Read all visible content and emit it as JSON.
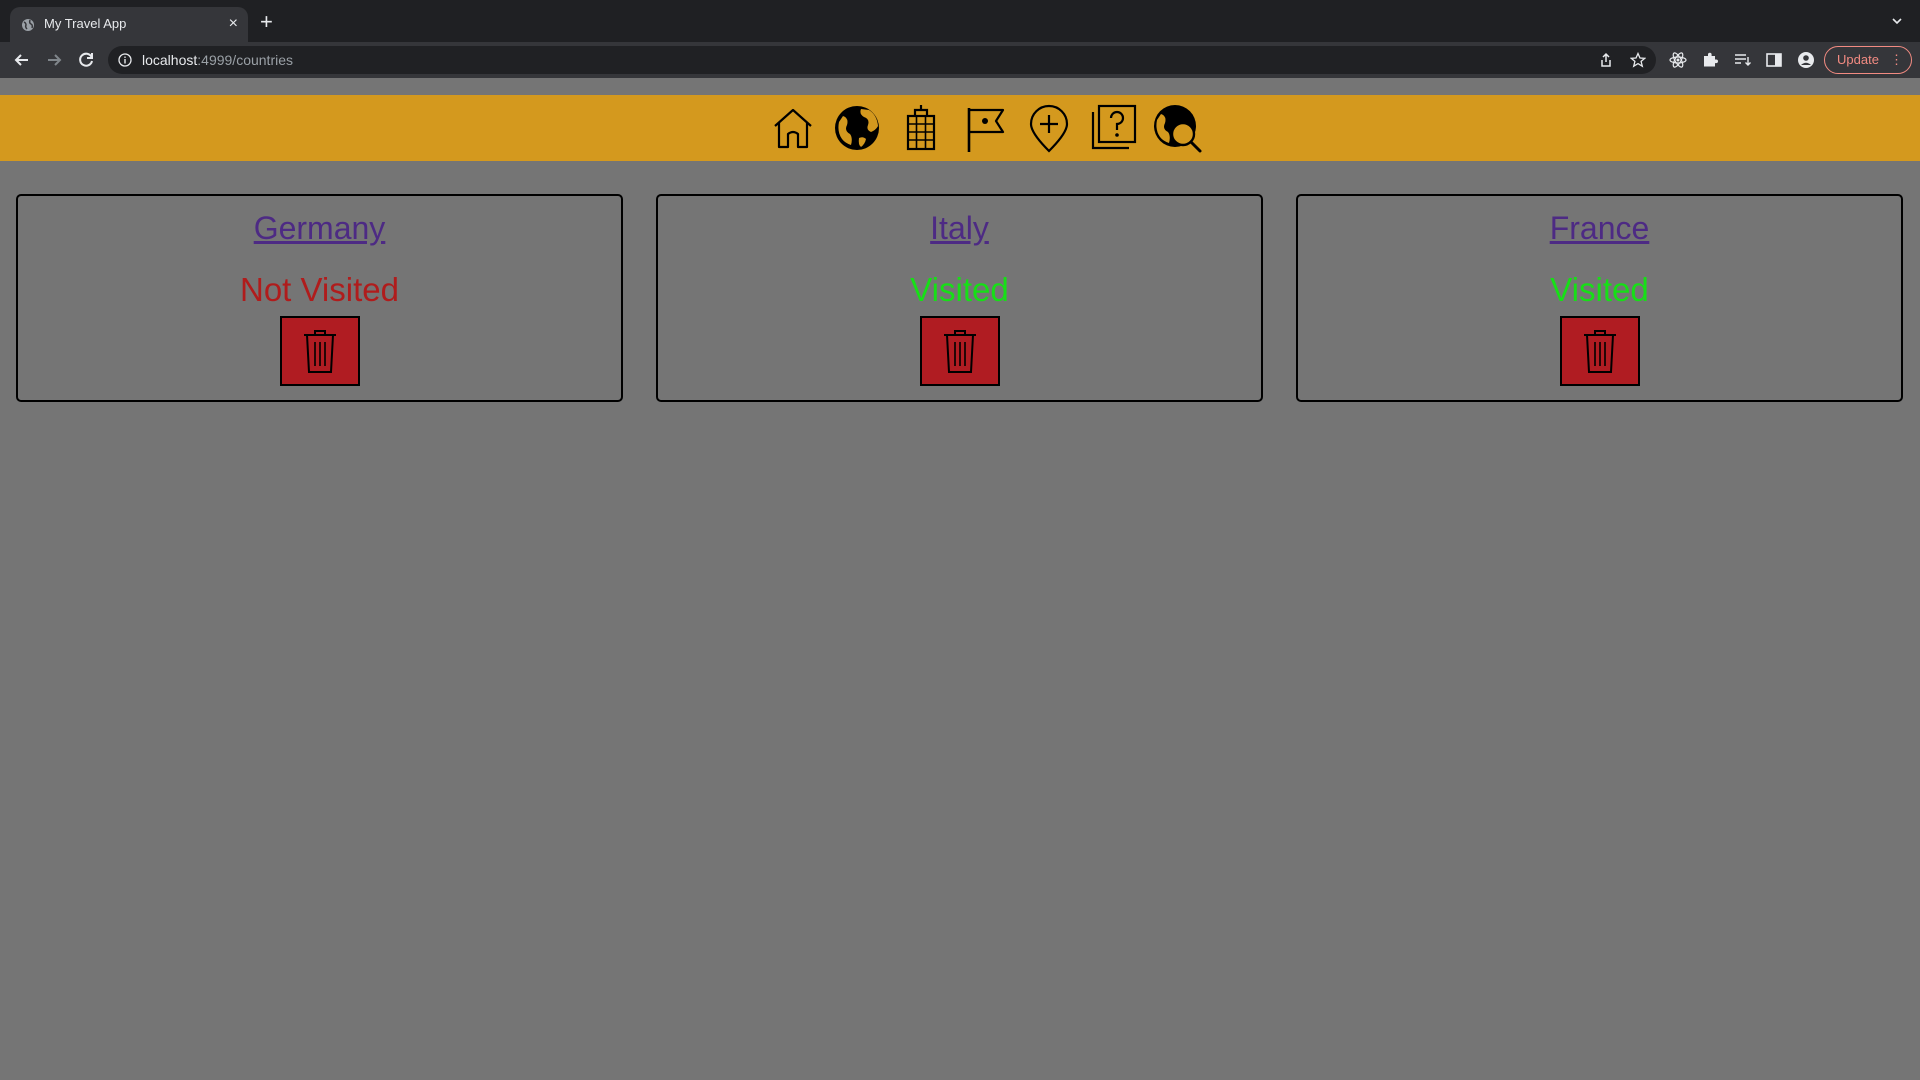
{
  "browser": {
    "tab_title": "My Travel App",
    "tab_close": "×",
    "new_tab": "+",
    "url_host": "localhost",
    "url_rest": ":4999/countries",
    "update_label": "Update",
    "menu_dots": "⋮"
  },
  "nav_icons": [
    "home-icon",
    "globe-icon",
    "city-building-icon",
    "flag-icon",
    "add-location-icon",
    "quiz-icon",
    "globe-search-icon"
  ],
  "colors": {
    "header": "#d4991e",
    "background": "#757575",
    "link": "#4d2a84",
    "not_visited": "#b01c1c",
    "visited": "#16e016",
    "delete": "#b01c22"
  },
  "countries": [
    {
      "name": "Germany",
      "status": "Not Visited",
      "visited": false
    },
    {
      "name": "Italy",
      "status": "Visited",
      "visited": true
    },
    {
      "name": "France",
      "status": "Visited",
      "visited": true
    }
  ]
}
